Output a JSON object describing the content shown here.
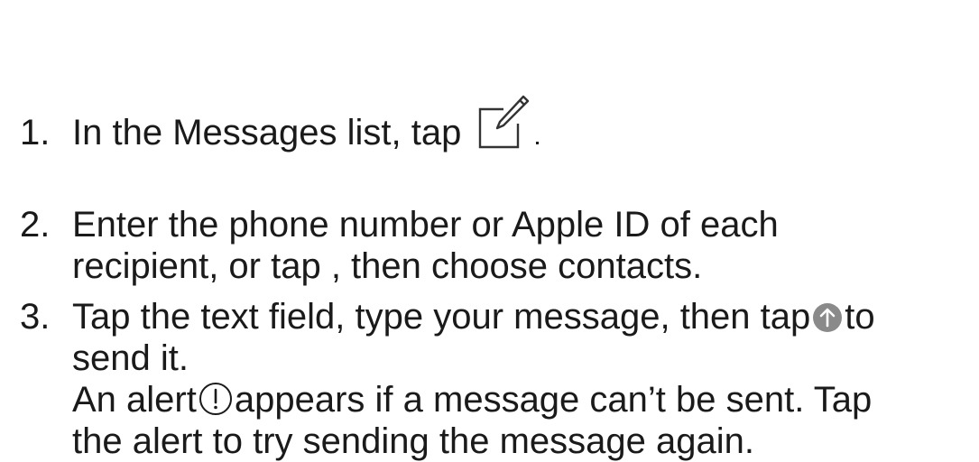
{
  "steps": [
    {
      "number": "1.",
      "text_before_icon": "In the Messages list, tap",
      "icon": "compose-icon"
    },
    {
      "number": "2.",
      "line1": "Enter the phone number or Apple ID of each",
      "line2": "recipient, or tap , then choose contacts."
    },
    {
      "number": "3.",
      "line1_before_icon": "Tap the text field, type your message, then tap",
      "line1_icon": "send-arrow-icon",
      "line1_after_icon": "to",
      "line2": "send it.",
      "line3_before_icon": "An alert",
      "line3_icon": "exclamation-alert-icon",
      "line3_after_icon": "appears if a message can’t be sent. Tap",
      "line4": "the alert to try sending the message again."
    }
  ],
  "colors": {
    "text": "#1a1a1a",
    "send_icon_fill": "#8a8a8a",
    "icon_stroke": "#1a1a1a"
  }
}
